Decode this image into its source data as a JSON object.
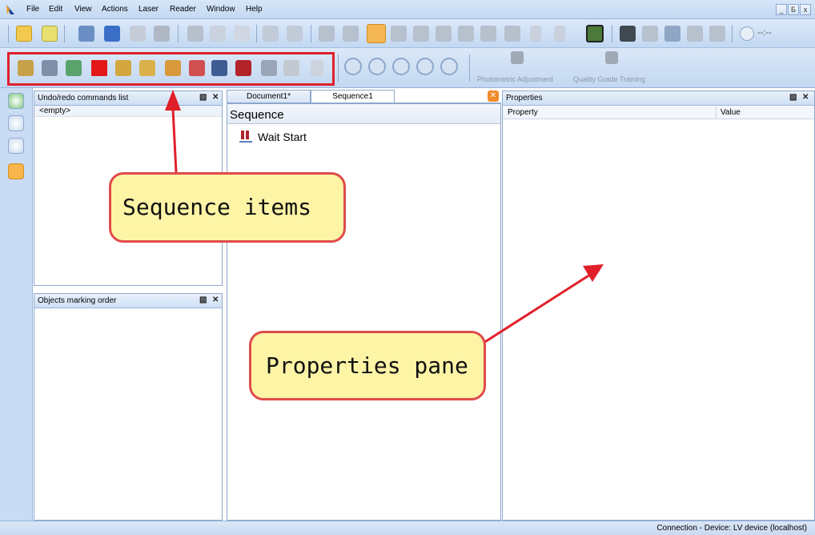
{
  "menu": [
    "File",
    "Edit",
    "View",
    "Actions",
    "Laser",
    "Reader",
    "Window",
    "Help"
  ],
  "window_controls": [
    "_",
    "Б",
    "x"
  ],
  "toolbar2": {
    "photometric_label": "Photometric Adjustment",
    "quality_label": "Quality Grade Training"
  },
  "undo_panel": {
    "title": "Undo/redo commands list",
    "empty_text": "<empty>"
  },
  "objects_panel": {
    "title": "Objects marking order"
  },
  "tabs": [
    "Document1*",
    "Sequence1"
  ],
  "sequence": {
    "header": "Sequence",
    "items": [
      "Wait Start"
    ]
  },
  "properties": {
    "title": "Properties",
    "col_property": "Property",
    "col_value": "Value"
  },
  "status": "Connection - Device: LV device (localhost)",
  "callouts": {
    "sequence_items": "Sequence items",
    "properties_pane": "Properties pane"
  },
  "colors": {
    "callout_fill": "#fdf4a6",
    "callout_border": "#e04b4b",
    "arrow": "#e0202a",
    "chrome": "#c9dcf4"
  }
}
